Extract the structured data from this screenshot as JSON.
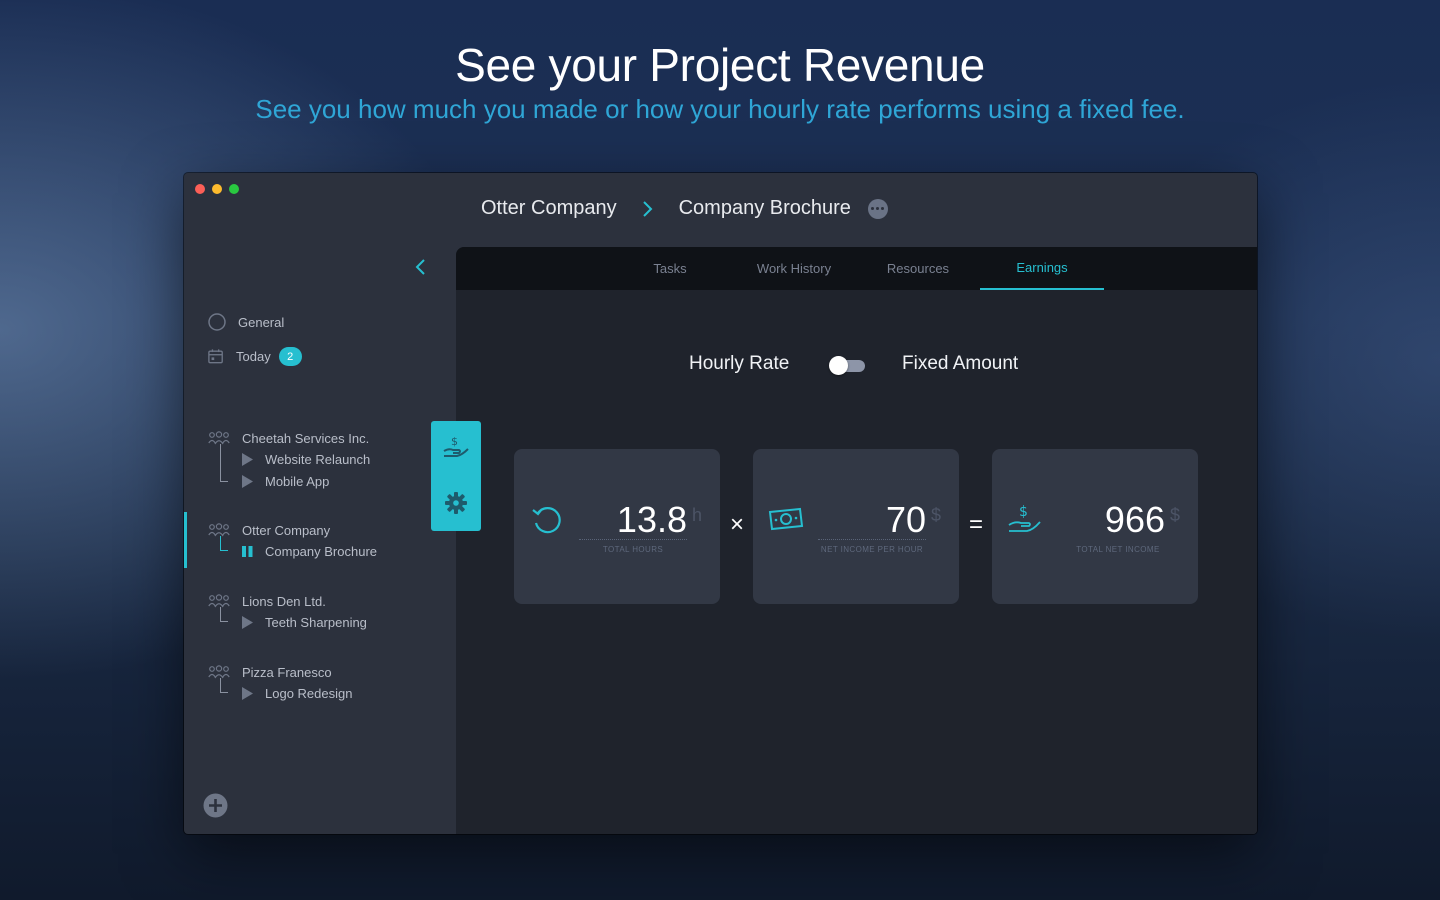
{
  "hero": {
    "title": "See your Project Revenue",
    "subtitle": "See you how much you made or how your hourly rate performs using a fixed fee."
  },
  "window": {
    "breadcrumb": {
      "client": "Otter Company",
      "project": "Company Brochure"
    }
  },
  "sidebar": {
    "general_label": "General",
    "today_label": "Today",
    "today_count": "2",
    "clients": [
      {
        "name": "Cheetah Services Inc.",
        "projects": [
          "Website Relaunch",
          "Mobile App"
        ]
      },
      {
        "name": "Otter Company",
        "projects": [
          "Company Brochure"
        ],
        "active_project": "Company Brochure"
      },
      {
        "name": "Lions Den Ltd.",
        "projects": [
          "Teeth Sharpening"
        ]
      },
      {
        "name": "Pizza Franesco",
        "projects": [
          "Logo Redesign"
        ]
      }
    ]
  },
  "tabs": [
    "Tasks",
    "Work History",
    "Resources",
    "Earnings"
  ],
  "active_tab": "Earnings",
  "earnings": {
    "toggle_left": "Hourly Rate",
    "toggle_right": "Fixed Amount",
    "toggle_state": "Hourly Rate",
    "hours": {
      "value": "13.8",
      "unit": "h",
      "caption": "TOTAL HOURS"
    },
    "multiply_symbol": "×",
    "rate": {
      "value": "70",
      "unit": "$",
      "caption": "NET INCOME PER HOUR"
    },
    "equals_symbol": "=",
    "total": {
      "value": "966",
      "unit": "$",
      "caption": "TOTAL NET INCOME"
    }
  },
  "colors": {
    "accent": "#26bfd0",
    "subtitle": "#2fa6d6",
    "window_bg": "#2c313d",
    "main_bg": "#1f232c",
    "card_bg": "#323845"
  },
  "icons": {
    "collapse": "chevron-left-icon",
    "general": "circle-icon",
    "today": "calendar-icon",
    "client": "people-icon",
    "project": "play-icon",
    "active_project": "pause-icon",
    "add": "plus-circle-icon",
    "earnings": "hand-dollar-icon",
    "settings": "gear-icon",
    "hours": "history-icon",
    "rate": "banknote-icon",
    "total": "hand-dollar-icon"
  }
}
